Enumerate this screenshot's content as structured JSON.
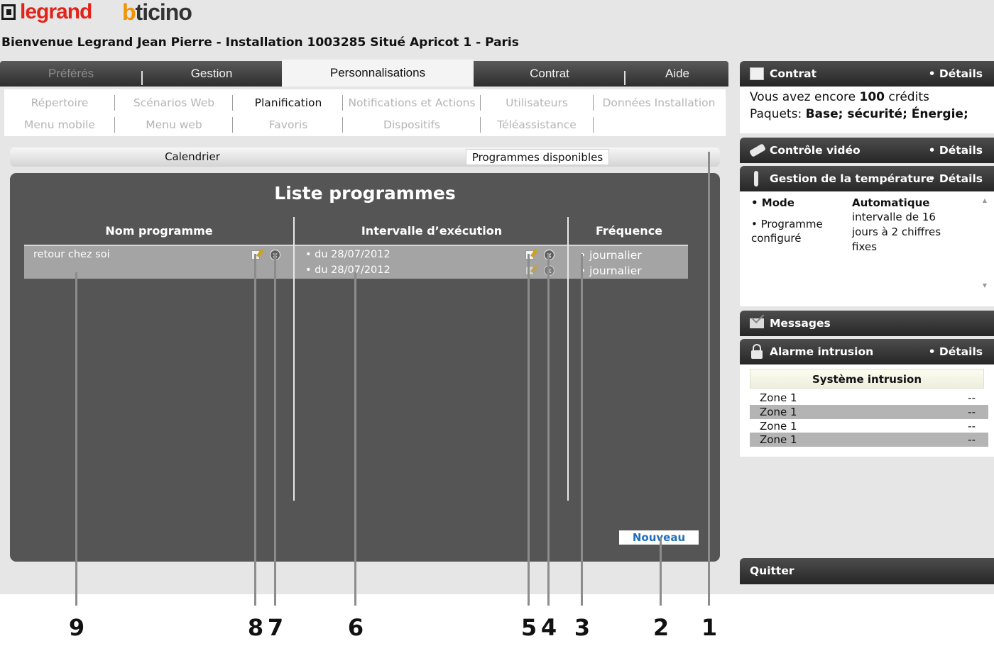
{
  "brand": {
    "legrand": "legrand",
    "bticino_b": "b",
    "bticino_rest": "ticino"
  },
  "welcome": "Bienvenue Legrand Jean Pierre - Installation 1003285 Situé Apricot 1 - Paris",
  "main_tabs": [
    {
      "label": "Préférés",
      "state": "disabled"
    },
    {
      "label": "Gestion",
      "state": "normal"
    },
    {
      "label": "Personnalisations",
      "state": "active"
    },
    {
      "label": "Contrat",
      "state": "normal"
    },
    {
      "label": "Aide",
      "state": "normal"
    }
  ],
  "subnav": {
    "row1": [
      "Répertoire",
      "Scénarios Web",
      "Planification",
      "Notifications et Actions",
      "Utilisateurs",
      "Données Installation"
    ],
    "row2": [
      "Menu mobile",
      "Menu web",
      "Favoris",
      "Dispositifs",
      "Téléassistance"
    ],
    "active": "Planification"
  },
  "section_tabs": {
    "calendar": "Calendrier",
    "programs": "Programmes disponibles"
  },
  "panel": {
    "title": "Liste programmes",
    "columns": {
      "name": "Nom programme",
      "interval": "Intervalle d’exécution",
      "frequency": "Fréquence"
    },
    "program_name": "retour chez soi",
    "intervals": [
      "• du 28/07/2012",
      "• du 28/07/2012"
    ],
    "frequencies": [
      "• journalier",
      "• journalier"
    ],
    "new_button": "Nouveau"
  },
  "sidebar": {
    "contrat": {
      "title": "Contrat",
      "details": "• Détails",
      "credits_prefix": "Vous avez encore ",
      "credits_value": "100",
      "credits_suffix": " crédits",
      "packages_label": "Paquets: ",
      "packages_value": "Base; sécurité; Énergie;"
    },
    "video": {
      "title": "Contrôle vidéo",
      "details": "• Détails"
    },
    "temperature": {
      "title": "Gestion de la température",
      "details": "• Détails",
      "mode_label": "• Mode",
      "mode_value": "Automatique",
      "program_label_1": "• Programme",
      "program_label_2": "configuré",
      "program_value_1": "intervalle de 16",
      "program_value_2": "jours à 2 chiffres",
      "program_value_3": "fixes"
    },
    "messages": {
      "title": "Messages"
    },
    "alarm": {
      "title": "Alarme intrusion",
      "details": "• Détails",
      "system": "Système intrusion",
      "zones": [
        {
          "name": "Zone 1",
          "value": "--"
        },
        {
          "name": "Zone 1",
          "value": "--"
        },
        {
          "name": "Zone 1",
          "value": "--"
        },
        {
          "name": "Zone 1",
          "value": "--"
        }
      ]
    },
    "quit": "Quitter"
  },
  "callouts": [
    "1",
    "2",
    "3",
    "4",
    "5",
    "6",
    "7",
    "8",
    "9"
  ],
  "colors": {
    "accent_link": "#1f6fbe",
    "legrand_red": "#e2231a",
    "bticino_orange": "#f29400",
    "panel_dark": "#555555"
  }
}
